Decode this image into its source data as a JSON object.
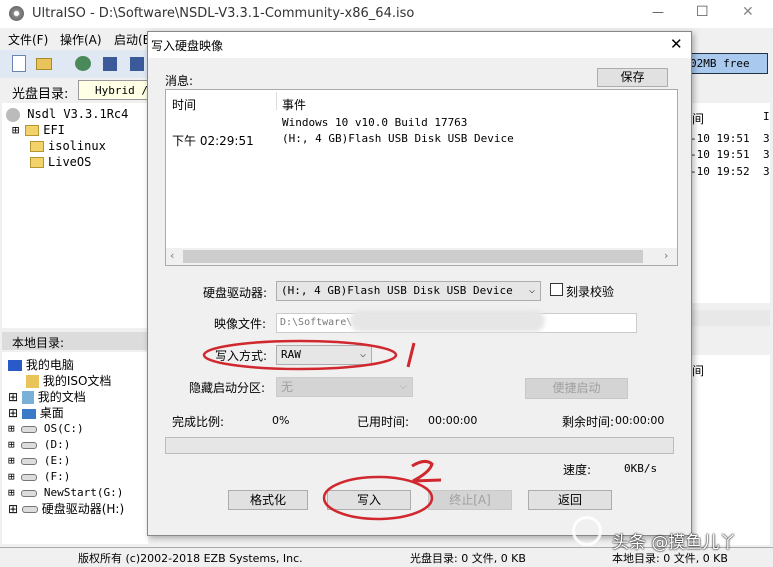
{
  "window": {
    "title": "UltraISO - D:\\Software\\NSDL-V3.3.1-Community-x86_64.iso",
    "minimize": "—",
    "maximize": "☐",
    "close": "✕"
  },
  "menu": [
    "文件(F)",
    "操作(A)",
    "启动(B"
  ],
  "toolbar": {
    "free_space": "02MB free"
  },
  "iso_dir": {
    "label": "光盘目录:",
    "path": "Hybrid /",
    "root": "Nsdl V3.3.1Rc4",
    "items": [
      "EFI",
      "isolinux",
      "LiveOS"
    ]
  },
  "right_list": {
    "header": "间",
    "header2": "I",
    "rows": [
      {
        "date": "-10 19:51",
        "col": "3"
      },
      {
        "date": "-10 19:51",
        "col": "3"
      },
      {
        "date": "-10 19:52",
        "col": "3"
      }
    ],
    "lower_header": "间"
  },
  "local_dir": {
    "label": "本地目录:",
    "root": "我的电脑",
    "items": [
      "我的ISO文档",
      "我的文档",
      "桌面",
      "OS(C:)",
      "(D:)",
      "(E:)",
      "(F:)",
      "NewStart(G:)",
      "硬盘驱动器(H:)"
    ]
  },
  "status": {
    "copyright": "版权所有 (c)2002-2018 EZB Systems, Inc.",
    "iso_stat": "光盘目录: 0 文件, 0 KB",
    "local_stat": "本地目录: 0 文件, 0 KB"
  },
  "dialog": {
    "title": "写入硬盘映像",
    "close": "✕",
    "messages_label": "消息:",
    "save": "保存",
    "log_headers": [
      "时间",
      "事件"
    ],
    "log": [
      {
        "time": "",
        "event": "Windows 10 v10.0 Build 17763"
      },
      {
        "time": "下午 02:29:51",
        "event": "(H:, 4 GB)Flash USB Disk USB Device"
      }
    ],
    "drive_label": "硬盘驱动器:",
    "drive_value": "(H:, 4 GB)Flash USB Disk USB Device",
    "verify_label": "刻录校验",
    "verify_checked": false,
    "image_label": "映像文件:",
    "image_value": "D:\\Software\\",
    "method_label": "写入方式:",
    "method_value": "RAW",
    "hidden_label": "隐藏启动分区:",
    "hidden_value": "无",
    "quick_boot": "便捷启动",
    "done_label": "完成比例:",
    "done_value": "0%",
    "elapsed_label": "已用时间:",
    "elapsed_value": "00:00:00",
    "remain_label": "剩余时间:",
    "remain_value": "00:00:00",
    "progress": 0,
    "speed_label": "速度:",
    "speed_value": "0KB/s",
    "buttons": {
      "format": "格式化",
      "write": "写入",
      "stop": "终止[A]",
      "back": "返回"
    }
  },
  "watermark": "头条 @摸鱼儿丫",
  "colors": {
    "annotation": "#d0282e",
    "accent": "#0078d7"
  }
}
